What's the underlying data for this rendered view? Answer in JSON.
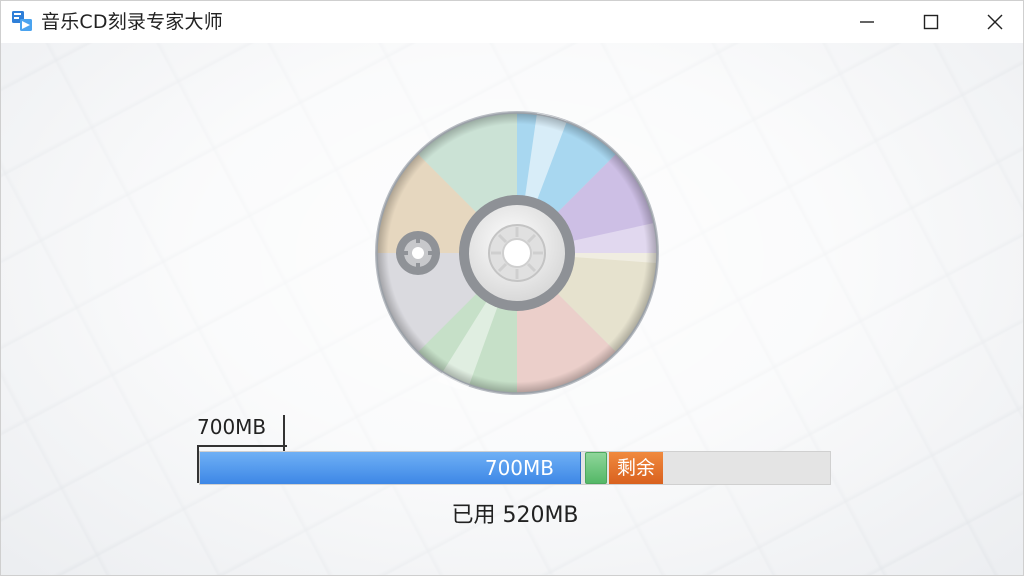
{
  "window": {
    "title": "音乐CD刻录专家大师",
    "controls": {
      "minimize_icon": "minimize-icon",
      "maximize_icon": "maximize-icon",
      "close_icon": "close-icon"
    }
  },
  "disc": {
    "icon": "cd-disc-icon"
  },
  "capacity": {
    "total_label": "700MB",
    "bar_label": "700MB",
    "remaining_label": "剩余",
    "used_text": "已用 520MB",
    "used_fraction": 0.6,
    "colors": {
      "used": "#3d87e6",
      "marker": "#54b867",
      "remaining": "#d9611f",
      "track": "#e4e4e4"
    }
  }
}
